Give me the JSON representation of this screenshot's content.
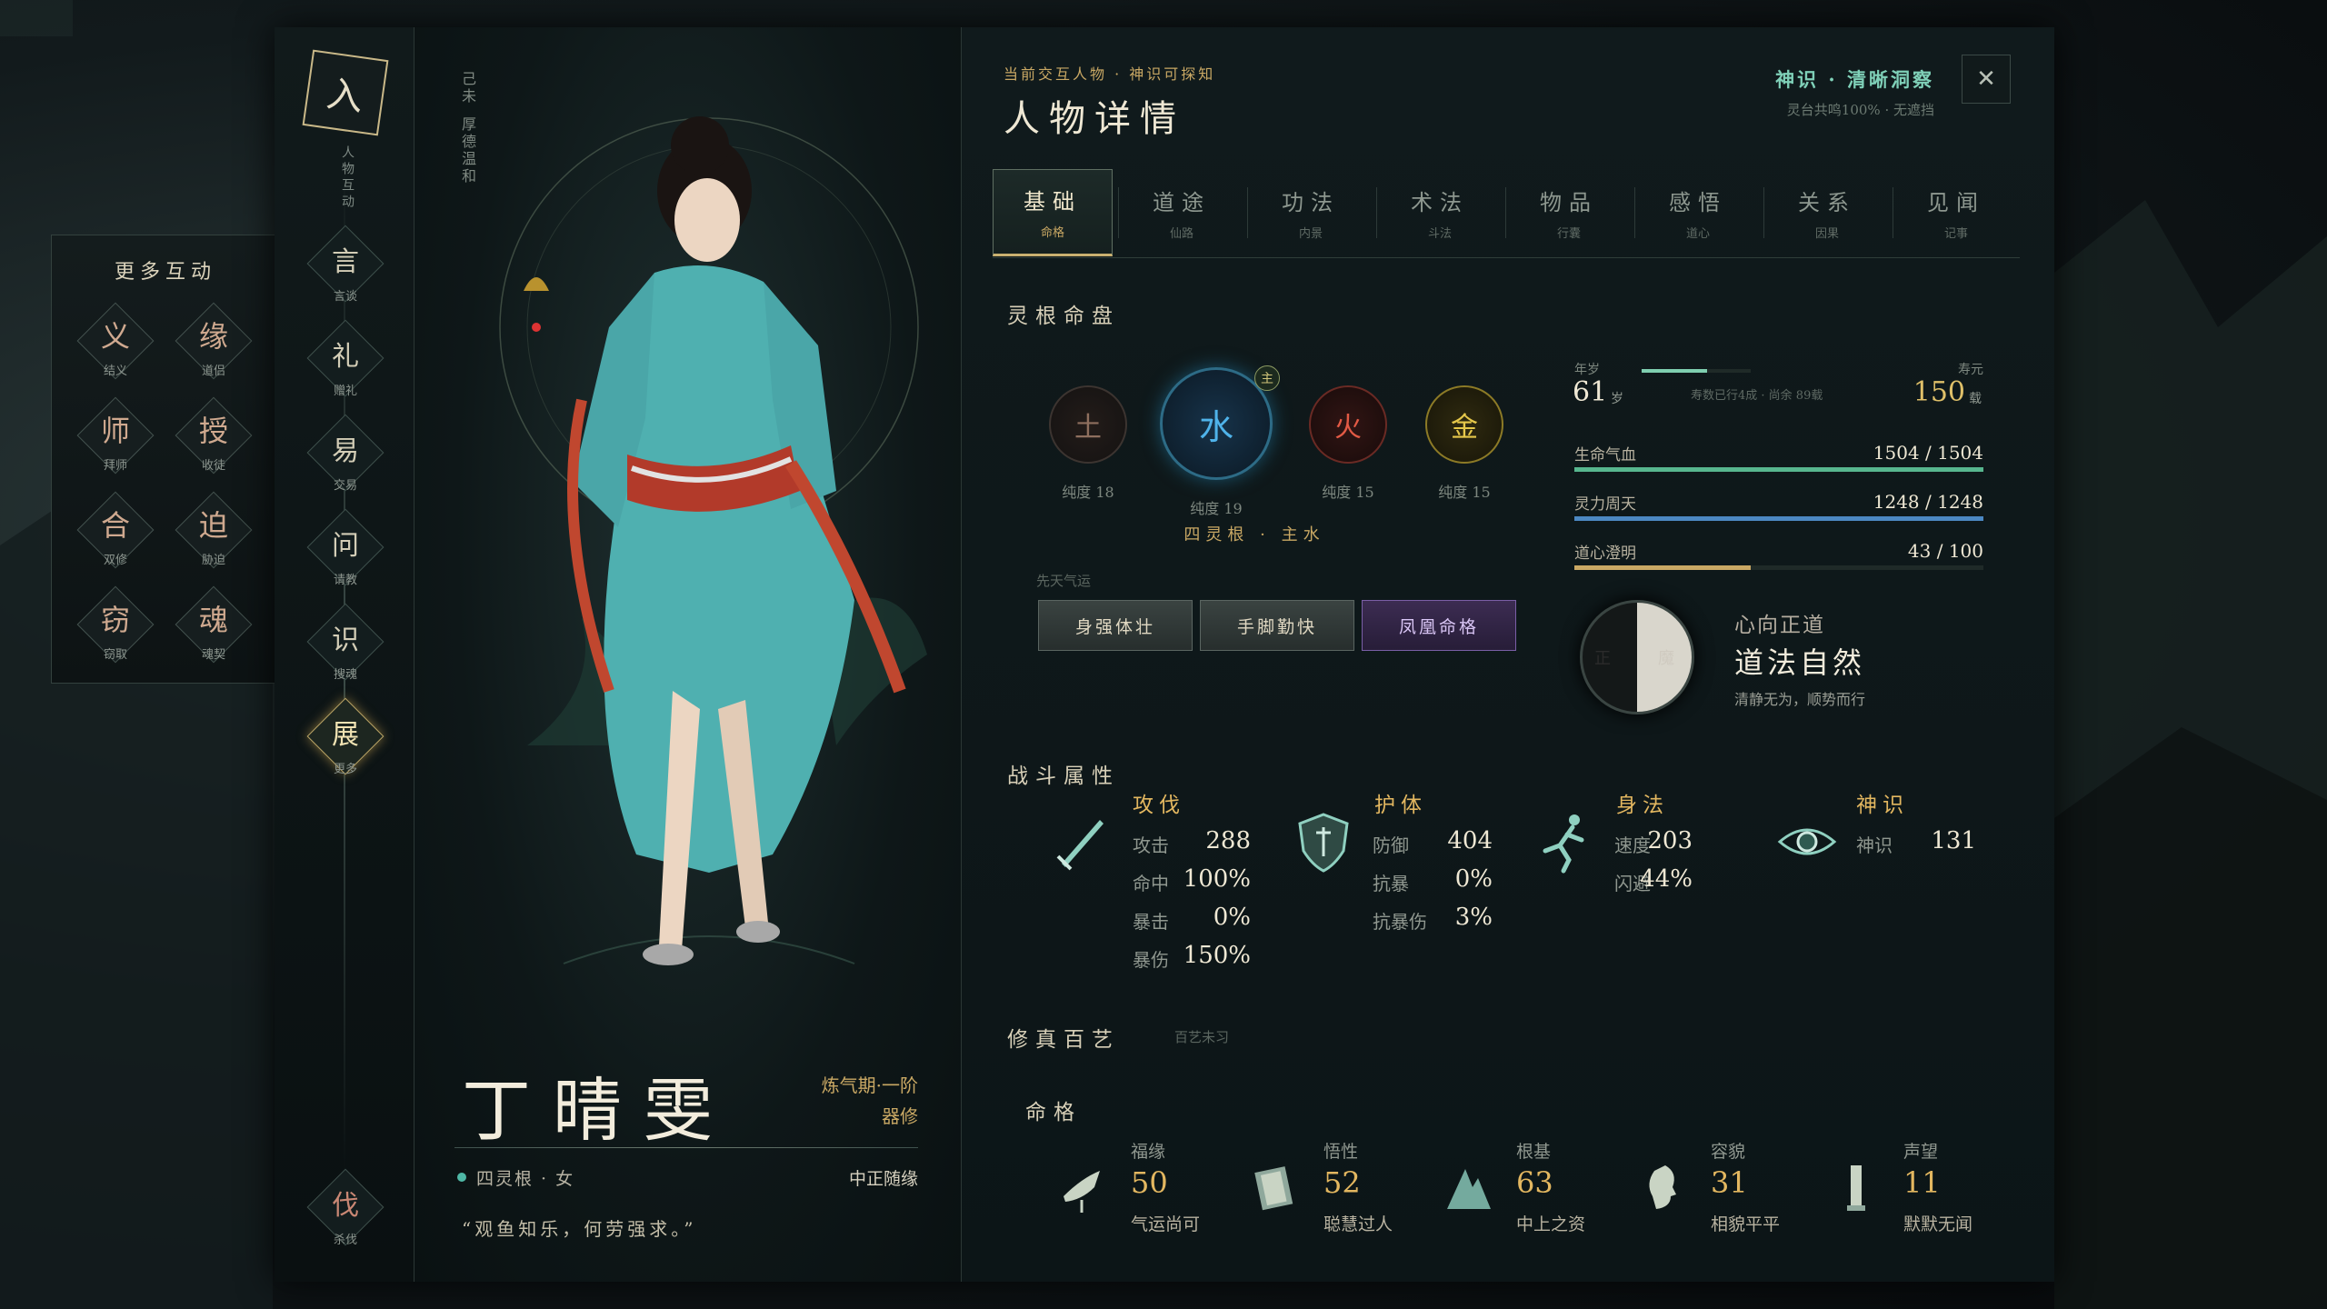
{
  "more_interactions": {
    "title": "更多互动",
    "items": [
      {
        "glyph": "义",
        "label": "结义"
      },
      {
        "glyph": "缘",
        "label": "道侣"
      },
      {
        "glyph": "师",
        "label": "拜师"
      },
      {
        "glyph": "授",
        "label": "收徒"
      },
      {
        "glyph": "合",
        "label": "双修"
      },
      {
        "glyph": "迫",
        "label": "胁迫"
      },
      {
        "glyph": "窃",
        "label": "窃取"
      },
      {
        "glyph": "魂",
        "label": "魂契"
      }
    ]
  },
  "nav": {
    "logo_glyph": "入",
    "vertical_text": "人物互动",
    "items": [
      {
        "glyph": "言",
        "label": "言谈"
      },
      {
        "glyph": "礼",
        "label": "赠礼"
      },
      {
        "glyph": "易",
        "label": "交易"
      },
      {
        "glyph": "问",
        "label": "请教"
      },
      {
        "glyph": "识",
        "label": "搜魂"
      },
      {
        "glyph": "展",
        "label": "更多"
      }
    ],
    "bottom": {
      "glyph": "伐",
      "label": "杀伐"
    }
  },
  "portrait": {
    "vertical_tag_1": "己未",
    "vertical_tag_2": "厚德温和",
    "name": "丁晴雯",
    "realm": "炼气期·一阶",
    "class": "器修",
    "root_info": "四灵根 · 女",
    "alignment": "中正随缘",
    "quote": "“观鱼知乐，何劳强求。”"
  },
  "header": {
    "subtitle": "当前交互人物 · 神识可探知",
    "title": "人物详情",
    "divine_sense": "神识 · 清晰洞察",
    "divine_sense_sub": "灵台共鸣100% · 无遮挡",
    "close": "✕"
  },
  "tabs": [
    {
      "label": "基础",
      "sub": "命格"
    },
    {
      "label": "道途",
      "sub": "仙路"
    },
    {
      "label": "功法",
      "sub": "内景"
    },
    {
      "label": "术法",
      "sub": "斗法"
    },
    {
      "label": "物品",
      "sub": "行囊"
    },
    {
      "label": "感悟",
      "sub": "道心"
    },
    {
      "label": "关系",
      "sub": "因果"
    },
    {
      "label": "见闻",
      "sub": "记事"
    }
  ],
  "spirit_root": {
    "title": "灵根命盘",
    "elements": [
      {
        "name": "土",
        "purity": "纯度 18",
        "color": "#8e6f5e"
      },
      {
        "name": "水",
        "purity": "纯度 19",
        "color": "#4fb3ea"
      },
      {
        "name": "火",
        "purity": "纯度 15",
        "color": "#e35a45"
      },
      {
        "name": "金",
        "purity": "纯度 15",
        "color": "#e6c84b"
      }
    ],
    "master_badge": "主",
    "summary": "四灵根 · 主水",
    "innate_label": "先天气运",
    "traits": [
      "身强体壮",
      "手脚勤快",
      "凤凰命格"
    ]
  },
  "vitals": {
    "age_label": "年岁",
    "age": "61",
    "age_unit": "岁",
    "age_progress": 0.6,
    "age_note": "寿数已行4成 · 尚余 89载",
    "lifespan_label": "寿元",
    "lifespan": "150",
    "lifespan_unit": "载",
    "bars": [
      {
        "label": "生命气血",
        "value": "1504 / 1504",
        "fraction": 1.0,
        "color": "#57b68e"
      },
      {
        "label": "灵力周天",
        "value": "1248 / 1248",
        "fraction": 1.0,
        "color": "#4c88c2"
      },
      {
        "label": "道心澄明",
        "value": "43 / 100",
        "fraction": 0.43,
        "color": "#c9a864"
      }
    ]
  },
  "dao": {
    "left": "正",
    "right": "魔",
    "tag": "心向正道",
    "name": "道法自然",
    "desc": "清静无为，顺势而行"
  },
  "combat": {
    "title": "战斗属性",
    "categories": [
      {
        "title": "攻伐",
        "stats": [
          [
            "攻击",
            "288"
          ],
          [
            "命中",
            "100%"
          ],
          [
            "暴击",
            "0%"
          ],
          [
            "暴伤",
            "150%"
          ]
        ]
      },
      {
        "title": "护体",
        "stats": [
          [
            "防御",
            "404"
          ],
          [
            "抗暴",
            "0%"
          ],
          [
            "抗暴伤",
            "3%"
          ]
        ]
      },
      {
        "title": "身法",
        "stats": [
          [
            "速度",
            "203"
          ],
          [
            "闪避",
            "44%"
          ]
        ]
      },
      {
        "title": "神识",
        "stats": [
          [
            "神识",
            "131"
          ]
        ]
      }
    ]
  },
  "arts": {
    "title": "修真百艺",
    "hint": "百艺未习"
  },
  "fate": {
    "title": "命格",
    "attrs": [
      {
        "label": "福缘",
        "value": "50",
        "desc": "气运尚可"
      },
      {
        "label": "悟性",
        "value": "52",
        "desc": "聪慧过人"
      },
      {
        "label": "根基",
        "value": "63",
        "desc": "中上之资"
      },
      {
        "label": "容貌",
        "value": "31",
        "desc": "相貌平平"
      },
      {
        "label": "声望",
        "value": "11",
        "desc": "默默无闻"
      }
    ]
  }
}
